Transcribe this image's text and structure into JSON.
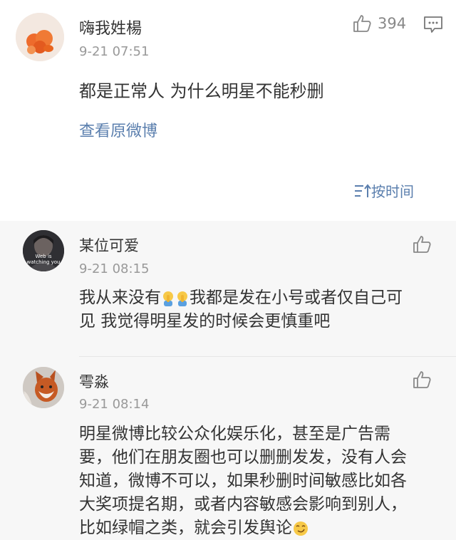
{
  "post": {
    "author": "嗨我姓楊",
    "time": "9-21 07:51",
    "text": "都是正常人 为什么明星不能秒删",
    "view_original": "查看原微博",
    "likes": "394",
    "sort_label": "按时间"
  },
  "comments": [
    {
      "author": "某位可爱",
      "avatar_text": "Web is watching you",
      "time": "9-21 08:15",
      "lines": [
        "我从来没有",
        "我都是发在小号或者仅自己可",
        "见 我觉得明星发的时候会更慎重吧"
      ]
    },
    {
      "author": "雩淼",
      "time": "9-21 08:14",
      "lines": [
        "明星微博比较公众化娱乐化，甚至是广告需",
        "要，他们在朋友圈也可以删删发发，没有人会",
        "知道，微博不可以，如果秒删时间敏感比如各",
        "大奖项提名期，或者内容敏感会影响到别人，",
        "比如绿帽之类，就会引发舆论"
      ]
    }
  ],
  "icons": [
    "thumbs-up-icon",
    "comment-icon",
    "sort-icon",
    "facepalm-emoji",
    "smirk-emoji"
  ]
}
